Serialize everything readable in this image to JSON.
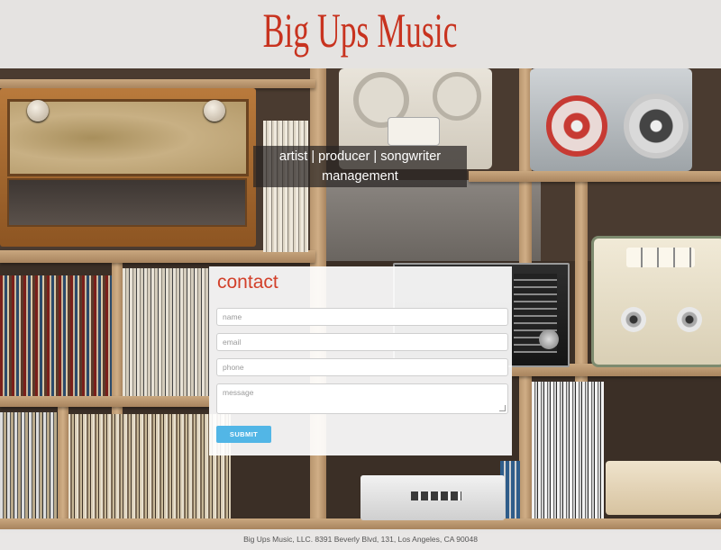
{
  "header": {
    "title": "Big Ups Music"
  },
  "tagline": {
    "line1": "artist | producer | songwriter",
    "line2": "management"
  },
  "contact": {
    "heading": "contact",
    "fields": {
      "name": {
        "placeholder": "name"
      },
      "email": {
        "placeholder": "email"
      },
      "phone": {
        "placeholder": "phone"
      },
      "message": {
        "placeholder": "message"
      }
    },
    "submit_label": "SUBMIT"
  },
  "footer": {
    "text": "Big Ups Music, LLC. 8391 Beverly Blvd, 131, Los Angeles, CA 90048"
  },
  "colors": {
    "brand": "#c8331f",
    "accent_button": "#52b6e6"
  },
  "background": {
    "description_icon": "vinyl-shelf-background"
  }
}
